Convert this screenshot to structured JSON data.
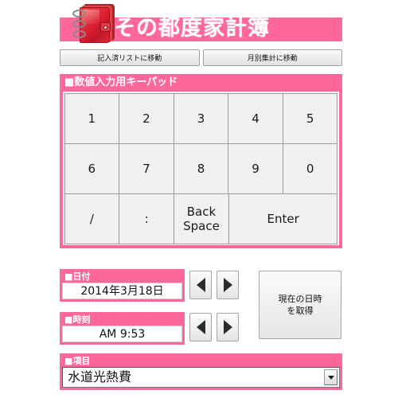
{
  "app": {
    "title": "その都度家計簿",
    "icon": "notebook-icon"
  },
  "topnav": {
    "buttons": [
      {
        "label": "記入済リストに移動"
      },
      {
        "label": "月別集計に移動"
      }
    ]
  },
  "keypad": {
    "header": "■数値入力用キーパッド",
    "rows": [
      [
        {
          "label": "1",
          "wide": false
        },
        {
          "label": "2",
          "wide": false
        },
        {
          "label": "3",
          "wide": false
        },
        {
          "label": "4",
          "wide": false
        },
        {
          "label": "5",
          "wide": false
        }
      ],
      [
        {
          "label": "6",
          "wide": false
        },
        {
          "label": "7",
          "wide": false
        },
        {
          "label": "8",
          "wide": false
        },
        {
          "label": "9",
          "wide": false
        },
        {
          "label": "0",
          "wide": false
        }
      ],
      [
        {
          "label": "/",
          "wide": false
        },
        {
          "label": ":",
          "wide": false
        },
        {
          "label": "Back\nSpace",
          "wide": false
        },
        {
          "label": "Enter",
          "wide": true
        }
      ]
    ]
  },
  "date_field": {
    "label": "■日付",
    "value": "2014年3月18日",
    "prev_icon": "triangle-left-icon",
    "next_icon": "triangle-right-icon"
  },
  "time_field": {
    "label": "■時刻",
    "value": "AM 9:53",
    "prev_icon": "triangle-left-icon",
    "next_icon": "triangle-right-icon"
  },
  "now_button": {
    "line1": "現在の日時",
    "line2": "を取得"
  },
  "item_field": {
    "label": "■項目",
    "selected": "水道光熱費",
    "arrow_icon": "chevron-down-icon"
  },
  "colors": {
    "accent_pink": "#ff6699",
    "key_face": "#eff0f0",
    "text": "#111111",
    "icon_red": "#e02233"
  }
}
